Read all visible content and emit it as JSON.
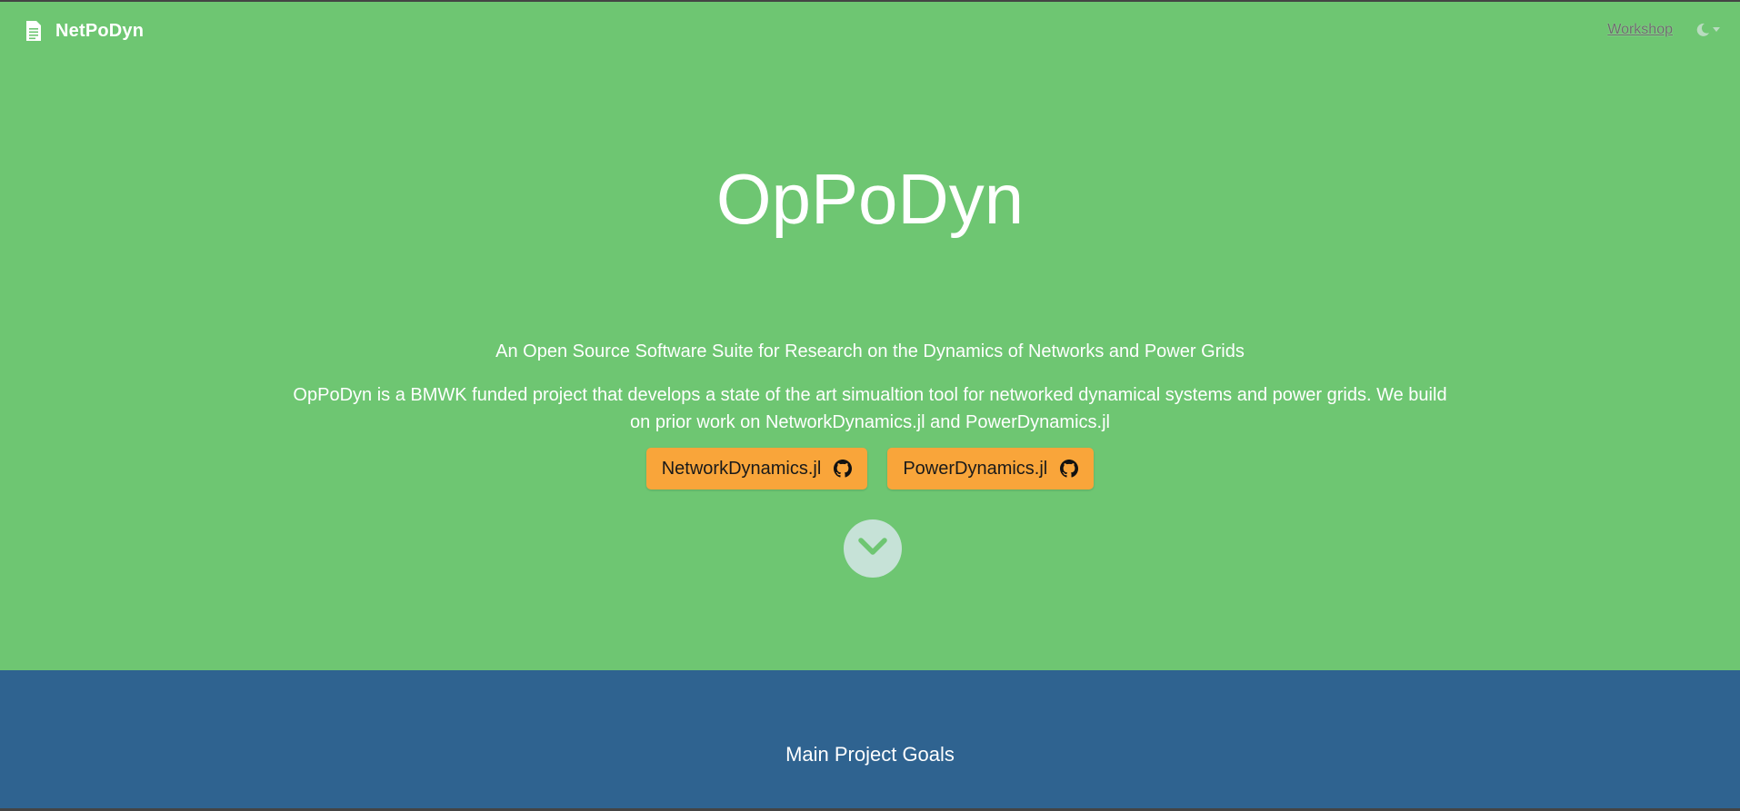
{
  "navbar": {
    "brand": "NetPoDyn",
    "brand_icon": "document-icon",
    "links": [
      {
        "label": "Workshop"
      }
    ],
    "theme_icon": "moon-icon"
  },
  "hero": {
    "title": "OpPoDyn",
    "subtitle": "An Open Source Software Suite for Research on the Dynamics of Networks and Power Grids",
    "description": "OpPoDyn is a BMWK funded project that develops a state of the art simualtion tool for networked dynamical systems and power grids. We build on prior work on NetworkDynamics.jl and PowerDynamics.jl",
    "buttons": [
      {
        "label": "NetworkDynamics.jl",
        "icon": "github-icon"
      },
      {
        "label": "PowerDynamics.jl",
        "icon": "github-icon"
      }
    ],
    "scroll_icon": "chevron-down-icon"
  },
  "goals": {
    "title": "Main Project Goals"
  },
  "colors": {
    "hero_bg": "#6ec672",
    "goals_bg": "#2f6390",
    "button_bg": "#f9a53a",
    "scroll_bg": "#c6e2d7"
  }
}
